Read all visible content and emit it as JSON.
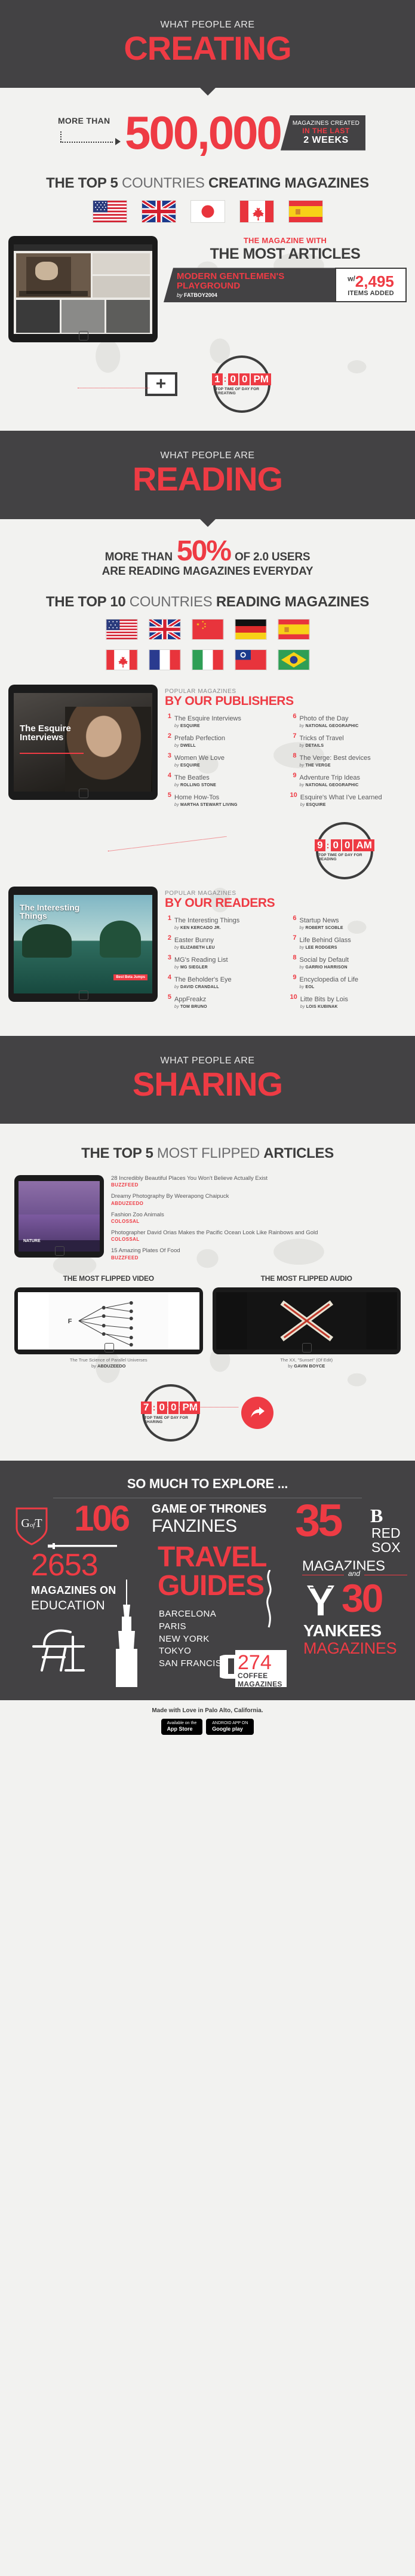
{
  "theme": {
    "red": "#ee3b44",
    "dark": "#434244",
    "light": "#f2f2f0",
    "grey": "#58585a"
  },
  "creating": {
    "kicker": "WHAT PEOPLE ARE",
    "title": "CREATING",
    "more_than": "MORE THAN",
    "big_number": "500,000",
    "tag_line1": "MAGAZINES CREATED",
    "tag_line2": "IN THE LAST",
    "tag_line3": "2 WEEKS",
    "countries_title_bold1": "THE TOP 5 ",
    "countries_title_thin": "COUNTRIES ",
    "countries_title_bold2": "CREATING MAGAZINES",
    "countries": [
      "United States",
      "United Kingdom",
      "Japan",
      "Canada",
      "Spain"
    ],
    "most_articles_kicker": "THE MAGAZINE WITH",
    "most_articles_title": "THE MOST ARTICLES",
    "magazine_name": "MODERN GENTLEMEN'S PLAYGROUND",
    "magazine_by_prefix": "by",
    "magazine_author": "FATBOY2004",
    "items_prefix": "w/",
    "items_count": "2,495",
    "items_label": "ITEMS ADDED",
    "clock_time": [
      "1",
      "0",
      "0",
      "PM"
    ],
    "clock_label": "TOP TIME OF DAY FOR CREATING"
  },
  "reading": {
    "kicker": "WHAT PEOPLE ARE",
    "title": "READING",
    "more_than": "MORE THAN",
    "percent": "50%",
    "of_users": "OF 2.0 USERS",
    "line2": "ARE READING MAGAZINES EVERYDAY",
    "countries_title_bold1": "THE TOP 10 ",
    "countries_title_thin": "COUNTRIES ",
    "countries_title_bold2": "READING MAGAZINES",
    "countries": [
      "United States",
      "United Kingdom",
      "China",
      "Germany",
      "Spain",
      "Canada",
      "France",
      "Italy",
      "Taiwan",
      "Brazil"
    ],
    "cover1_title": "The Esquire Interviews",
    "cover2_title": "The Interesting Things",
    "publishers": {
      "kicker": "POPULAR MAGAZINES",
      "title": "BY OUR PUBLISHERS",
      "items": [
        {
          "rank": "1",
          "name": "The Esquire Interviews",
          "by": "ESQUIRE"
        },
        {
          "rank": "2",
          "name": "Prefab Perfection",
          "by": "DWELL"
        },
        {
          "rank": "3",
          "name": "Women We Love",
          "by": "ESQUIRE"
        },
        {
          "rank": "4",
          "name": "The Beatles",
          "by": "ROLLING STONE"
        },
        {
          "rank": "5",
          "name": "Home How-Tos",
          "by": "MARTHA STEWART LIVING"
        },
        {
          "rank": "6",
          "name": "Photo of the Day",
          "by": "NATIONAL GEOGRAPHIC"
        },
        {
          "rank": "7",
          "name": "Tricks of Travel",
          "by": "DETAILS"
        },
        {
          "rank": "8",
          "name": "The Verge: Best devices",
          "by": "THE VERGE"
        },
        {
          "rank": "9",
          "name": "Adventure Trip Ideas",
          "by": "NATIONAL GEOGRAPHIC"
        },
        {
          "rank": "10",
          "name": "Esquire's What I've Learned",
          "by": "ESQUIRE"
        }
      ]
    },
    "readers": {
      "kicker": "POPULAR MAGAZINES",
      "title": "BY OUR READERS",
      "items": [
        {
          "rank": "1",
          "name": "The Interesting Things",
          "by": "KEN KERCADO JR."
        },
        {
          "rank": "2",
          "name": "Easter Bunny",
          "by": "ELIZABETH LEU"
        },
        {
          "rank": "3",
          "name": "MG's Reading List",
          "by": "MG SIEGLER"
        },
        {
          "rank": "4",
          "name": "The Beholder's Eye",
          "by": "DAVID CRANDALL"
        },
        {
          "rank": "5",
          "name": "AppFreakz",
          "by": "TOM BRUNO"
        },
        {
          "rank": "6",
          "name": "Startup News",
          "by": "ROBERT SCOBLE"
        },
        {
          "rank": "7",
          "name": "Life Behind Glass",
          "by": "LEE RODGERS"
        },
        {
          "rank": "8",
          "name": "Social by Default",
          "by": "GARRIO HARRISON"
        },
        {
          "rank": "9",
          "name": "Encyclopedia of Life",
          "by": "EOL"
        },
        {
          "rank": "10",
          "name": "Litte Bits by Lois",
          "by": "LOIS KUBINAK"
        }
      ]
    },
    "clock_time": [
      "9",
      "0",
      "0",
      "AM"
    ],
    "clock_label": "TOP TIME OF DAY FOR READING"
  },
  "sharing": {
    "kicker": "WHAT PEOPLE ARE",
    "title": "SHARING",
    "articles_title_bold1": "THE TOP 5 ",
    "articles_title_thin": "MOST FLIPPED ",
    "articles_title_bold2": "ARTICLES",
    "articles": [
      {
        "title": "28 Incredibly Beautiful Places You Won't Believe Actually Exist",
        "source": "BUZZFEED"
      },
      {
        "title": "Dreamy Photography By Weerapong Chaipuck",
        "source": "ABDUZEEDO"
      },
      {
        "title": "Fashion Zoo Animals",
        "source": "COLOSSAL"
      },
      {
        "title": "Photographer David Orias Makes the Pacific Ocean Look Like Rainbows and Gold",
        "source": "COLOSSAL"
      },
      {
        "title": "15 Amazing Plates Of Food",
        "source": "BUZZFEED"
      }
    ],
    "video_head": "THE MOST FLIPPED VIDEO",
    "video_caption_prefix": "The True Science of Parallel Universes",
    "video_caption_by": "by",
    "video_caption_author": "ABDUZEEDO",
    "audio_head": "THE MOST FLIPPED AUDIO",
    "audio_caption_prefix": "The XX, \"Sunset\" (Of Edit)",
    "audio_caption_by": "by",
    "audio_caption_author": "GAVIN BOYCE",
    "clock_time": [
      "7",
      "0",
      "0",
      "PM"
    ],
    "clock_label": "TOP TIME OF DAY FOR SHARING"
  },
  "explore": {
    "headline": "SO MUCH TO EXPLORE ...",
    "got_badge": "G of T",
    "got_number": "106",
    "got_line1": "GAME OF THRONES",
    "got_line2": "FANZINES",
    "edu_number": "2653",
    "edu_line1": "MAGAZINES ON",
    "edu_line2": "EDUCATION",
    "travel_line1": "TRAVEL",
    "travel_line2": "GUIDES",
    "travel_cities": [
      "BARCELONA",
      "PARIS",
      "NEW YORK",
      "TOKYO",
      "SAN FRANCISCO"
    ],
    "coffee_number": "274",
    "coffee_line1": "COFFEE",
    "coffee_line2": "MAGAZINES",
    "redsox_number": "35",
    "redsox_line1": "RED",
    "redsox_line2": "SOX",
    "redsox_line3": "MAGAZINES",
    "and_label": "and",
    "yankees_number": "30",
    "yankees_line1": "YANKEES",
    "yankees_line2": "MAGAZINES"
  },
  "footer": {
    "made": "Made with Love in Palo Alto, California.",
    "app_store_small": "Available on the",
    "app_store_big": "App Store",
    "play_small": "ANDROID APP ON",
    "play_big": "Google play"
  }
}
